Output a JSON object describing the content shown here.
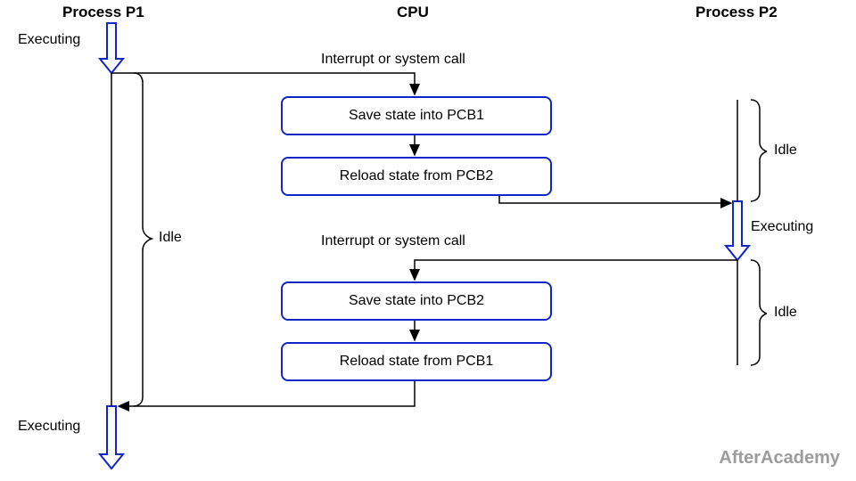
{
  "headers": {
    "p1": "Process P1",
    "cpu": "CPU",
    "p2": "Process P2"
  },
  "labels": {
    "exec_top": "Executing",
    "exec_mid": "Executing",
    "exec_bot": "Executing",
    "idle_left": "Idle",
    "idle_r1": "Idle",
    "idle_r2": "Idle",
    "int1": "Interrupt or system call",
    "int2": "Interrupt or system call"
  },
  "boxes": {
    "save1": "Save state into PCB1",
    "reload2": "Reload state from PCB2",
    "save2": "Save state into PCB2",
    "reload1": "Reload state from PCB1"
  },
  "watermark": "AfterAcademy"
}
